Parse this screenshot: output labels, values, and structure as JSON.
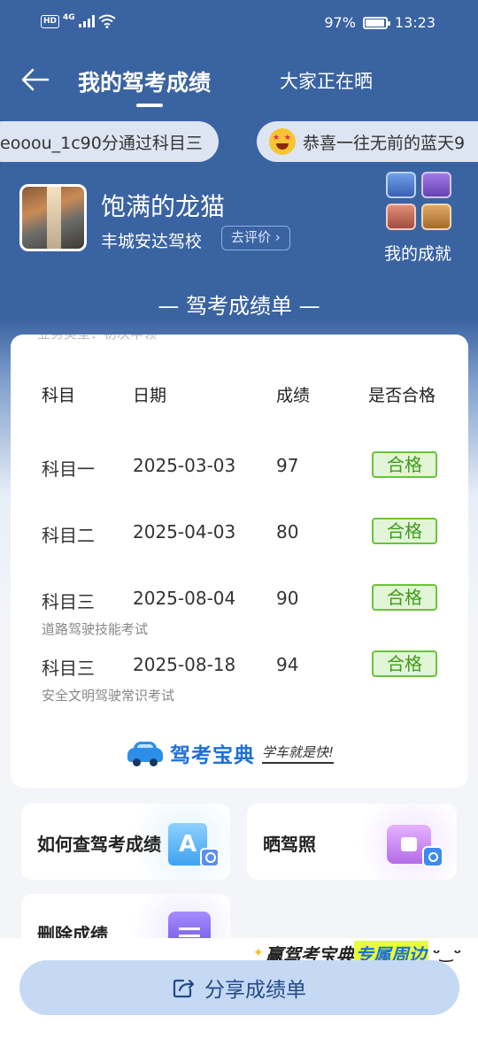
{
  "status_bar": {
    "network": "HD",
    "signal": "4G",
    "battery": "97%",
    "time": "13:23"
  },
  "nav": {
    "title": "我的驾考成绩",
    "tab_other": "大家正在晒"
  },
  "marquee": {
    "item1": "eooou_1c90分通过科目三",
    "item2": "恭喜一往无前的蓝天9"
  },
  "profile": {
    "name": "饱满的龙猫",
    "school": "丰城安达驾校",
    "rate_button": "去评价",
    "achievements_label": "我的成就"
  },
  "section_title": "— 驾考成绩单 —",
  "card": {
    "partial_top_text": "业务类型：初次申领",
    "headers": [
      "科目",
      "日期",
      "成绩",
      "是否合格"
    ],
    "rows": [
      {
        "subject": "科目一",
        "date": "2025-03-03",
        "score": "97",
        "result": "合格",
        "note": ""
      },
      {
        "subject": "科目二",
        "date": "2025-04-03",
        "score": "80",
        "result": "合格",
        "note": ""
      },
      {
        "subject": "科目三",
        "date": "2025-08-04",
        "score": "90",
        "result": "合格",
        "note": "道路驾驶技能考试"
      },
      {
        "subject": "科目三",
        "date": "2025-08-18",
        "score": "94",
        "result": "合格",
        "note": "安全文明驾驶常识考试"
      }
    ],
    "brand_name": "驾考宝典",
    "brand_slogan": "学车就是快!"
  },
  "features": {
    "check_scores": "如何查驾考成绩",
    "share_license": "晒驾照",
    "delete_scores": "删除成绩"
  },
  "promo": {
    "part1": "赢驾考宝典",
    "part2": "专属周边"
  },
  "share_button": "分享成绩单",
  "colors": {
    "header_blue": "#3a63a1",
    "pass_green": "#68c43a",
    "brand_blue": "#1d6fd8",
    "share_bg": "#c5d9f5"
  }
}
